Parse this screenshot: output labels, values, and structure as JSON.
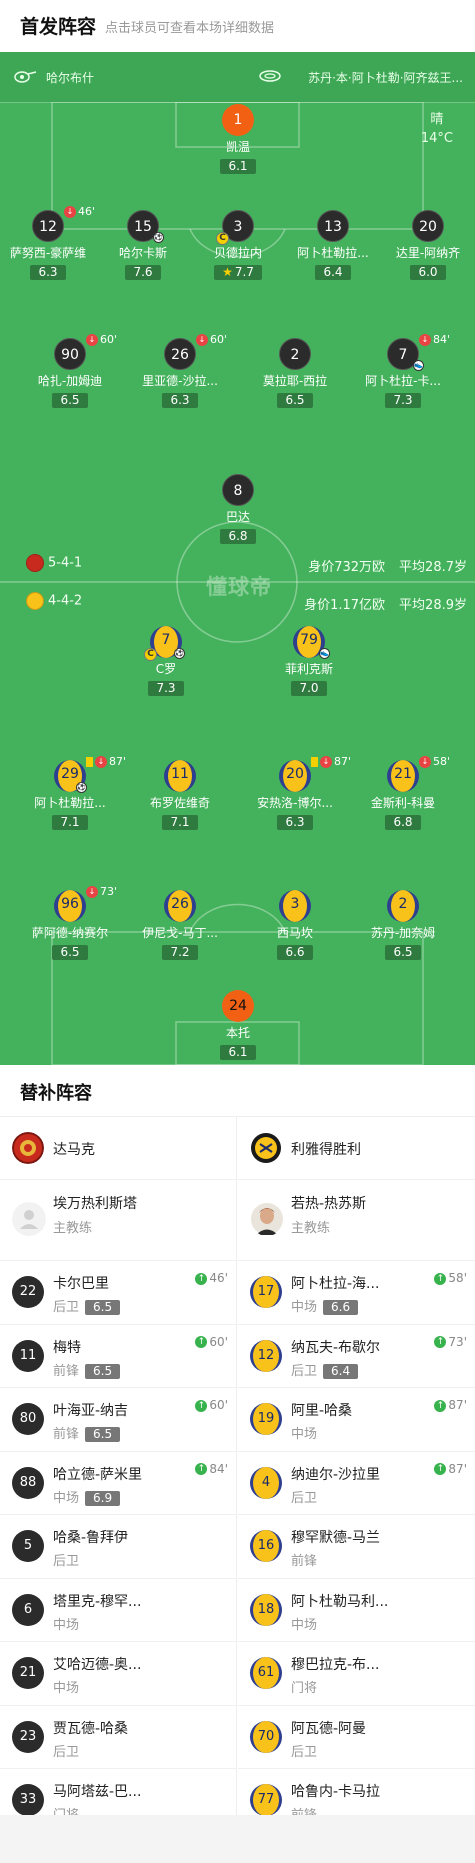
{
  "header": {
    "title": "首发阵容",
    "subtitle": "点击球员可查看本场详细数据"
  },
  "pitch": {
    "home_team": "哈尔布什",
    "away_team": "苏丹·本·阿卜杜勒·阿齐兹王...",
    "weather": {
      "condition": "晴",
      "temperature": "14°C"
    },
    "watermark": "懂球帝",
    "home_formation": "5-4-1",
    "home_value": "身价732万欧",
    "home_age": "平均28.7岁",
    "away_formation": "4-4-2",
    "away_value": "身价1.17亿欧",
    "away_age": "平均28.9岁",
    "colors": {
      "pitch": "#44b25c",
      "home_shirt": "#2b2b2b",
      "away_shirt": "#f8c21a",
      "away_trim": "#2e3f8f",
      "keeper": "#f26014"
    }
  },
  "home_players": [
    {
      "num": "1",
      "name": "凯温",
      "rating": "6.1"
    },
    {
      "num": "12",
      "name": "萨努西-豪萨维",
      "rating": "6.3",
      "sub_min": "46'"
    },
    {
      "num": "15",
      "name": "哈尔卡斯",
      "rating": "7.6"
    },
    {
      "num": "3",
      "name": "贝德拉内",
      "rating": "7.7"
    },
    {
      "num": "13",
      "name": "阿卜杜勒拉...",
      "rating": "6.4"
    },
    {
      "num": "20",
      "name": "达里-阿纳齐",
      "rating": "6.0"
    },
    {
      "num": "90",
      "name": "哈扎-加姆迪",
      "rating": "6.5",
      "sub_min": "60'"
    },
    {
      "num": "26",
      "name": "里亚德-沙拉...",
      "rating": "6.3",
      "sub_min": "60'"
    },
    {
      "num": "2",
      "name": "莫拉耶-西拉",
      "rating": "6.5"
    },
    {
      "num": "7",
      "name": "阿卜杜拉-卡...",
      "rating": "7.3",
      "sub_min": "84'"
    },
    {
      "num": "8",
      "name": "巴达",
      "rating": "6.8"
    }
  ],
  "away_players": [
    {
      "num": "7",
      "name": "C罗",
      "rating": "7.3"
    },
    {
      "num": "79",
      "name": "菲利克斯",
      "rating": "7.0"
    },
    {
      "num": "29",
      "name": "阿卜杜勒拉...",
      "rating": "7.1",
      "sub_min": "87'"
    },
    {
      "num": "11",
      "name": "布罗佐维奇",
      "rating": "7.1"
    },
    {
      "num": "20",
      "name": "安热洛-博尔...",
      "rating": "6.3",
      "sub_min": "87'"
    },
    {
      "num": "21",
      "name": "金斯利-科曼",
      "rating": "6.8",
      "sub_min": "58'"
    },
    {
      "num": "96",
      "name": "萨阿德-纳赛尔",
      "rating": "6.5",
      "sub_min": "73'"
    },
    {
      "num": "26",
      "name": "伊尼戈-马丁...",
      "rating": "7.2"
    },
    {
      "num": "3",
      "name": "西马坎",
      "rating": "6.6"
    },
    {
      "num": "2",
      "name": "苏丹-加奈姆",
      "rating": "6.5"
    },
    {
      "num": "24",
      "name": "本托",
      "rating": "6.1"
    }
  ],
  "subs": {
    "title": "替补阵容",
    "home": {
      "team": "达马克",
      "coach": {
        "name": "埃万热利斯塔",
        "role": "主教练"
      },
      "players": [
        {
          "num": "22",
          "name": "卡尔巴里",
          "pos": "后卫",
          "rating": "6.5",
          "min": "46'"
        },
        {
          "num": "11",
          "name": "梅特",
          "pos": "前锋",
          "rating": "6.5",
          "min": "60'"
        },
        {
          "num": "80",
          "name": "叶海亚-纳吉",
          "pos": "前锋",
          "rating": "6.5",
          "min": "60'"
        },
        {
          "num": "88",
          "name": "哈立德-萨米里",
          "pos": "中场",
          "rating": "6.9",
          "min": "84'"
        },
        {
          "num": "5",
          "name": "哈桑-鲁拜伊",
          "pos": "后卫"
        },
        {
          "num": "6",
          "name": "塔里克-穆罕...",
          "pos": "中场"
        },
        {
          "num": "21",
          "name": "艾哈迈德-奥...",
          "pos": "中场"
        },
        {
          "num": "23",
          "name": "贾瓦德-哈桑",
          "pos": "后卫"
        },
        {
          "num": "33",
          "name": "马阿塔兹-巴...",
          "pos": "门将"
        }
      ]
    },
    "away": {
      "team": "利雅得胜利",
      "coach": {
        "name": "若热-热苏斯",
        "role": "主教练"
      },
      "players": [
        {
          "num": "17",
          "name": "阿卜杜拉-海...",
          "pos": "中场",
          "rating": "6.6",
          "min": "58'"
        },
        {
          "num": "12",
          "name": "纳瓦夫-布歇尔",
          "pos": "后卫",
          "rating": "6.4",
          "min": "73'"
        },
        {
          "num": "19",
          "name": "阿里-哈桑",
          "pos": "中场",
          "min": "87'"
        },
        {
          "num": "4",
          "name": "纳迪尔-沙拉里",
          "pos": "后卫",
          "min": "87'"
        },
        {
          "num": "16",
          "name": "穆罕默德-马兰",
          "pos": "前锋"
        },
        {
          "num": "18",
          "name": "阿卜杜勒马利...",
          "pos": "中场"
        },
        {
          "num": "61",
          "name": "穆巴拉克-布...",
          "pos": "门将"
        },
        {
          "num": "70",
          "name": "阿瓦德-阿曼",
          "pos": "后卫"
        },
        {
          "num": "77",
          "name": "哈鲁内-卡马拉",
          "pos": "前锋"
        }
      ]
    }
  }
}
